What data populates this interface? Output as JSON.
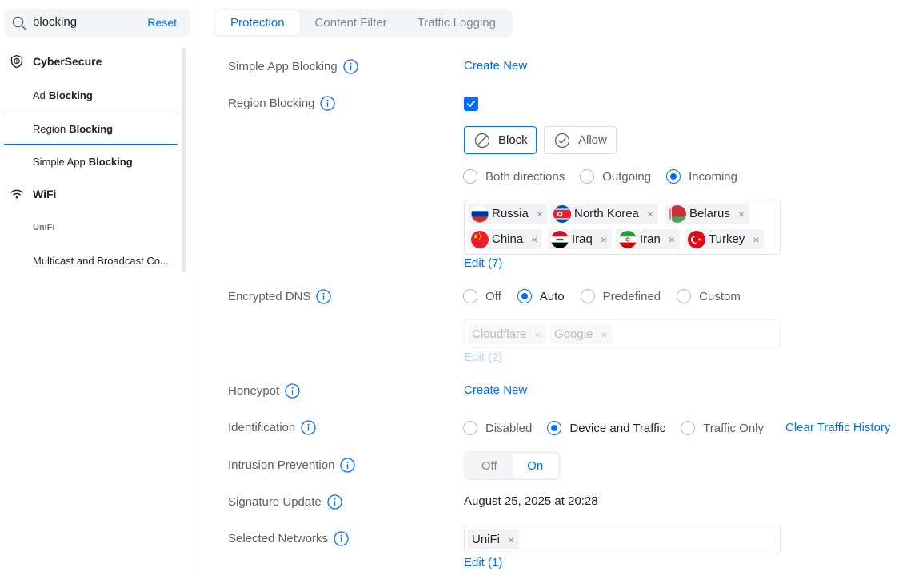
{
  "search": {
    "value": "blocking",
    "reset_label": "Reset"
  },
  "sidebar": {
    "group1": {
      "label": "CyberSecure",
      "icon": "shield-icon"
    },
    "items": [
      {
        "prefix": "Ad",
        "match": "Blocking"
      },
      {
        "prefix": "Region",
        "match": "Blocking"
      },
      {
        "prefix": "Simple App",
        "match": "Blocking"
      }
    ],
    "group2": {
      "label": "WiFi",
      "icon": "wifi-icon"
    },
    "sub_header": "UniFi",
    "last_item": "Multicast and Broadcast Co..."
  },
  "tabs": [
    "Protection",
    "Content Filter",
    "Traffic Logging"
  ],
  "rows": {
    "simple_app": {
      "label": "Simple App Blocking",
      "action": "Create New"
    },
    "region": {
      "label": "Region Blocking",
      "checked": true,
      "block_label": "Block",
      "allow_label": "Allow",
      "directions": [
        "Both directions",
        "Outgoing",
        "Incoming"
      ],
      "selected_direction": "Incoming",
      "countries": [
        {
          "name": "Russia"
        },
        {
          "name": "North Korea"
        },
        {
          "name": "Belarus"
        },
        {
          "name": "China"
        },
        {
          "name": "Iraq"
        },
        {
          "name": "Iran"
        },
        {
          "name": "Turkey"
        }
      ],
      "edit_label": "Edit (7)"
    },
    "dns": {
      "label": "Encrypted DNS",
      "options": [
        "Off",
        "Auto",
        "Predefined",
        "Custom"
      ],
      "selected": "Auto",
      "servers": [
        "Cloudflare",
        "Google"
      ],
      "edit_label": "Edit (2)"
    },
    "honeypot": {
      "label": "Honeypot",
      "action": "Create New"
    },
    "identification": {
      "label": "Identification",
      "options": [
        "Disabled",
        "Device and Traffic",
        "Traffic Only"
      ],
      "selected": "Device and Traffic",
      "action": "Clear Traffic History"
    },
    "ips": {
      "label": "Intrusion Prevention",
      "off_label": "Off",
      "on_label": "On",
      "state": "On"
    },
    "signature": {
      "label": "Signature Update",
      "value": "August 25, 2025 at 20:28"
    },
    "networks": {
      "label": "Selected Networks",
      "items": [
        "UniFi"
      ],
      "edit_label": "Edit (1)"
    }
  },
  "colors": {
    "accent": "#006fff",
    "text": "#212327",
    "muted": "#5b6068"
  }
}
